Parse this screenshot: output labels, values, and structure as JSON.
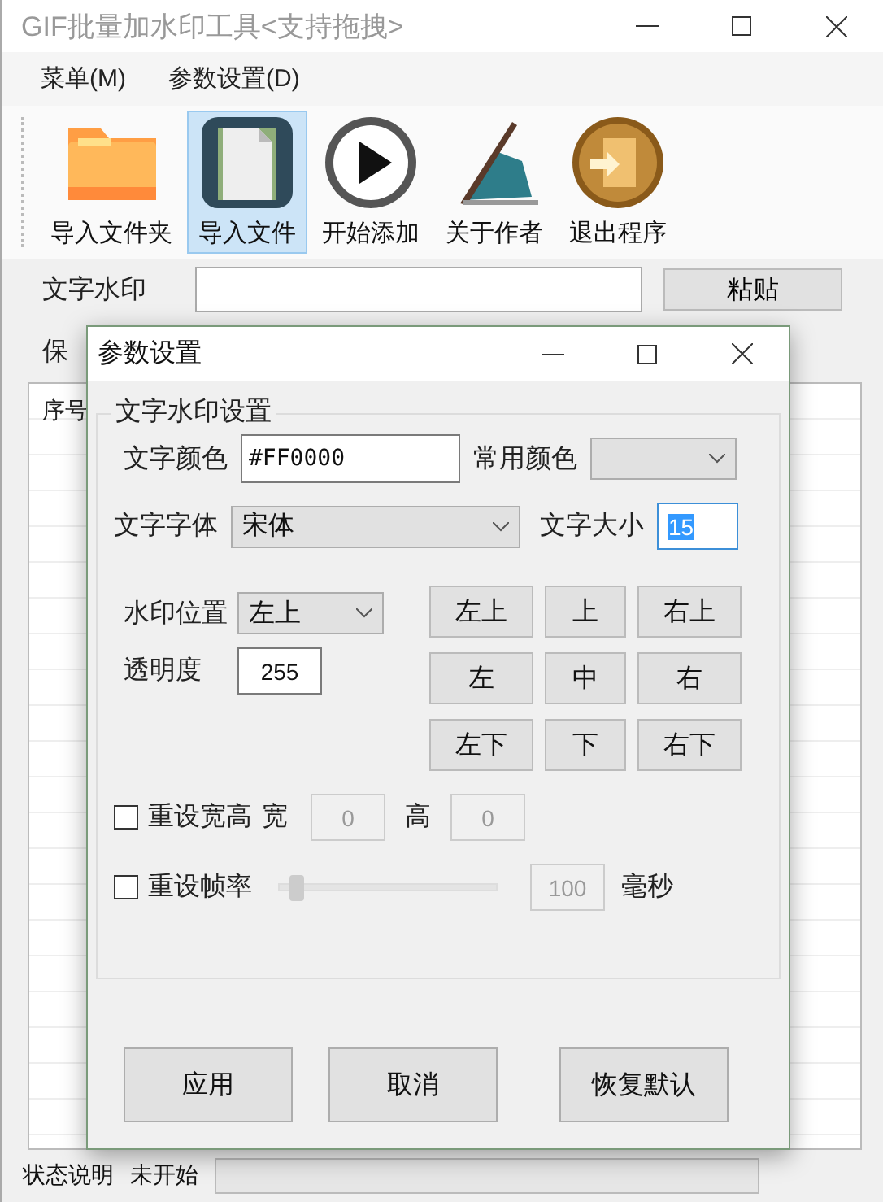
{
  "window": {
    "title": "GIF批量加水印工具<支持拖拽>"
  },
  "menu": [
    "菜单(M)",
    "参数设置(D)"
  ],
  "toolbar": [
    {
      "label": "导入文件夹",
      "kind": "folder",
      "selected": false
    },
    {
      "label": "导入文件",
      "kind": "document",
      "selected": true
    },
    {
      "label": "开始添加",
      "kind": "play",
      "selected": false
    },
    {
      "label": "关于作者",
      "kind": "pen",
      "selected": false
    },
    {
      "label": "退出程序",
      "kind": "exit",
      "selected": false
    }
  ],
  "text_watermark": {
    "label": "文字水印",
    "button": "粘贴"
  },
  "save_row": {
    "label": "保"
  },
  "list": {
    "columns": [
      "序号"
    ]
  },
  "status_bar": {
    "label": "状态说明",
    "status": "未开始",
    "level": 0
  },
  "dialog": {
    "title": "参数设置",
    "group": "文字水印设置",
    "color_label": "文字颜色",
    "color_value": "#FF0000",
    "common_color_label": "常用颜色",
    "font_label": "文字字体",
    "font_value": "宋体",
    "size_label": "文字大小",
    "size_value": "15",
    "size_text_selected": true,
    "position_label": "水印位置",
    "position_value": "左上",
    "opacity_label": "透明度",
    "opacity_value": "255",
    "position_buttons": [
      "左上",
      "上",
      "右上",
      "左",
      "中",
      "右",
      "左下",
      "下",
      "右下"
    ],
    "resize": {
      "label": "重设宽高",
      "checked": false,
      "width_label": "宽",
      "width_value": "0",
      "height_label": "高",
      "height_value": "0"
    },
    "framerate": {
      "label": "重设帧率",
      "checked": false,
      "level": 0.05,
      "value": "100",
      "unit": "毫秒"
    },
    "buttons": [
      "应用",
      "取消",
      "恢复默认"
    ]
  }
}
